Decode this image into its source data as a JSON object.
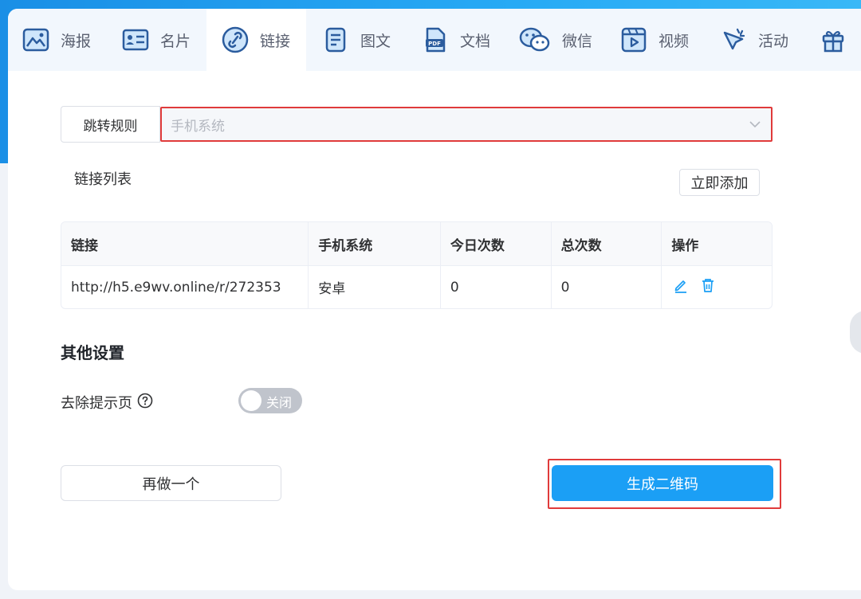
{
  "tabs": [
    {
      "label": "海报",
      "icon": "poster-icon",
      "active": false
    },
    {
      "label": "名片",
      "icon": "business-card-icon",
      "active": false
    },
    {
      "label": "链接",
      "icon": "link-icon",
      "active": true
    },
    {
      "label": "图文",
      "icon": "article-icon",
      "active": false
    },
    {
      "label": "文档",
      "icon": "pdf-document-icon",
      "active": false
    },
    {
      "label": "微信",
      "icon": "wechat-icon",
      "active": false
    },
    {
      "label": "视频",
      "icon": "video-icon",
      "active": false
    },
    {
      "label": "活动",
      "icon": "activity-icon",
      "active": false
    },
    {
      "label": "",
      "icon": "gift-icon",
      "active": false
    }
  ],
  "rule": {
    "label": "跳转规则",
    "select_value": "手机系统"
  },
  "link_list": {
    "title": "链接列表",
    "add_button": "立即添加"
  },
  "table": {
    "headers": [
      "链接",
      "手机系统",
      "今日次数",
      "总次数",
      "操作"
    ],
    "rows": [
      {
        "link": "http://h5.e9wv.online/r/272353",
        "system": "安卓",
        "today": "0",
        "total": "0"
      }
    ]
  },
  "other_settings": {
    "title": "其他设置",
    "remove_tip_label": "去除提示页",
    "toggle_text": "关闭",
    "toggle_on": false
  },
  "buttons": {
    "again": "再做一个",
    "generate": "生成二维码"
  },
  "colors": {
    "primary": "#1b9ff5",
    "highlight": "#e03b3b",
    "toggle_off": "#c0c4cc"
  }
}
